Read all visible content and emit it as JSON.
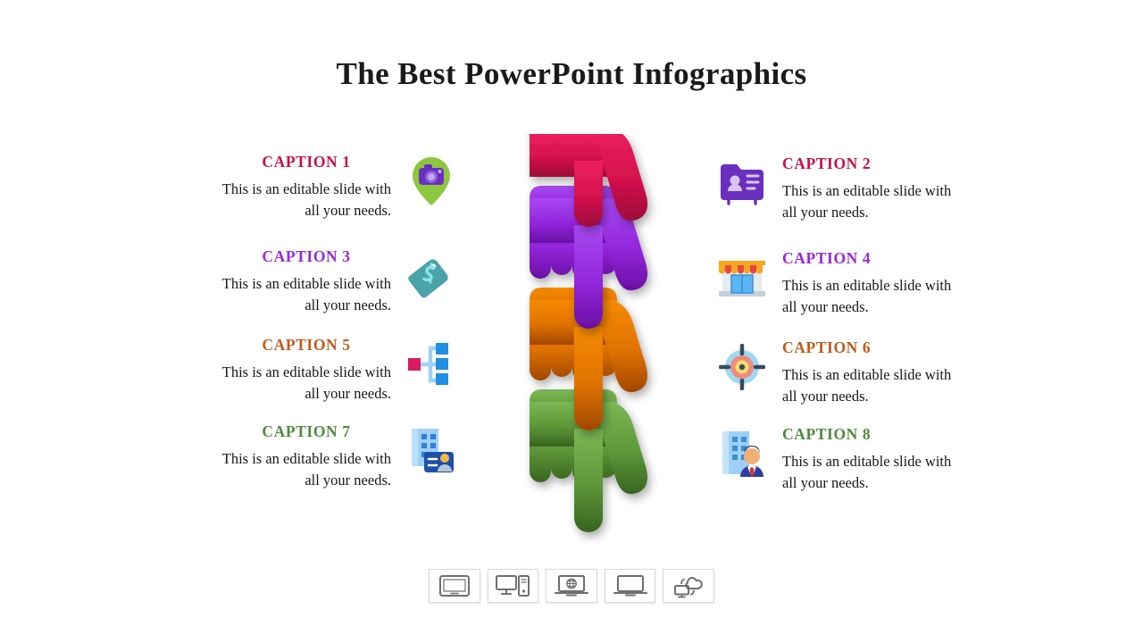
{
  "slide": {
    "title": "The Best PowerPoint Infographics",
    "background_color": "#ffffff"
  },
  "colors": {
    "crimson": "#C8104B",
    "purple": "#8E2BD6",
    "orange": "#C05A18",
    "green": "#4E8B3B",
    "body_text": "#171717",
    "device_icon": "#6f6f6f"
  },
  "captions": [
    {
      "id": 1,
      "side": "left",
      "title": "CAPTION 1",
      "body": "This is an editable slide with all your needs.",
      "color": "#C8104B",
      "icon": "location-pin-camera-icon"
    },
    {
      "id": 2,
      "side": "right",
      "title": "CAPTION 2",
      "body": "This is an editable slide with all your needs.",
      "color": "#C8104B",
      "icon": "contact-folder-icon"
    },
    {
      "id": 3,
      "side": "left",
      "title": "CAPTION 3",
      "body": "This is an editable slide with all your needs.",
      "color": "#9A28D6",
      "icon": "price-tag-dollar-icon"
    },
    {
      "id": 4,
      "side": "right",
      "title": "CAPTION 4",
      "body": "This is an editable slide with all your needs.",
      "color": "#9A28D6",
      "icon": "storefront-icon"
    },
    {
      "id": 5,
      "side": "left",
      "title": "CAPTION 5",
      "body": "This is an editable slide with all your needs.",
      "color": "#C05A18",
      "icon": "org-chart-hierarchy-icon"
    },
    {
      "id": 6,
      "side": "right",
      "title": "CAPTION 6",
      "body": "This is an editable slide with all your needs.",
      "color": "#C05A18",
      "icon": "target-crosshair-icon"
    },
    {
      "id": 7,
      "side": "left",
      "title": "CAPTION 7",
      "body": "This is an editable slide with all your needs.",
      "color": "#4E8B3B",
      "icon": "office-building-id-badge-icon"
    },
    {
      "id": 8,
      "side": "right",
      "title": "CAPTION 8",
      "body": "This is an editable slide with all your needs.",
      "color": "#4E8B3B",
      "icon": "office-building-businessman-icon"
    }
  ],
  "center_graphic": {
    "name": "layered-paint-drip-hands",
    "layers": [
      {
        "label": "layer-1",
        "color_top": "#E8185E",
        "color_bottom": "#A4093F"
      },
      {
        "label": "layer-2",
        "color_top": "#A33BEE",
        "color_bottom": "#6E0FA8"
      },
      {
        "label": "layer-3",
        "color_top": "#F08000",
        "color_bottom": "#A84800"
      },
      {
        "label": "layer-4",
        "color_top": "#6FAA4A",
        "color_bottom": "#3B6B22"
      }
    ]
  },
  "device_strip": [
    {
      "label": "tablet",
      "icon": "tablet-icon"
    },
    {
      "label": "desktop",
      "icon": "desktop-tower-icon"
    },
    {
      "label": "web-laptop",
      "icon": "laptop-globe-icon"
    },
    {
      "label": "laptop",
      "icon": "laptop-icon"
    },
    {
      "label": "cloud",
      "icon": "cloud-sync-icon"
    }
  ]
}
